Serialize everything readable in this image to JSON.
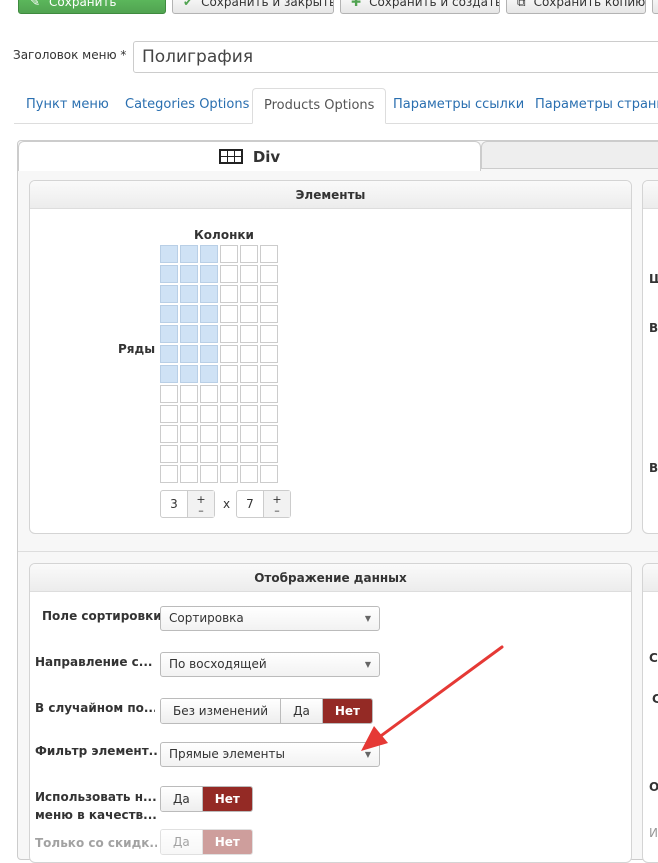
{
  "toolbar": {
    "save": "Сохранить",
    "save_close": "Сохранить и закрыть",
    "save_new": "Сохранить и создать",
    "save_copy": "Сохранить копию"
  },
  "menu_title": {
    "label": "Заголовок меню *",
    "value": "Полиграфия"
  },
  "tabs": [
    "Пункт меню",
    "Categories Options",
    "Products Options",
    "Параметры ссылки",
    "Параметры страницы"
  ],
  "active_tab": "Products Options",
  "subtab": {
    "label": "Div"
  },
  "elements_panel": {
    "title": "Элементы",
    "columns_label": "Колонки",
    "rows_label": "Ряды",
    "columns_value": "3",
    "rows_value": "7",
    "times": "x",
    "plus": "+",
    "minus": "–",
    "grid_selected": {
      "columns": 3,
      "rows": 7
    },
    "grid_size": {
      "columns": 6,
      "rows": 12
    }
  },
  "display_panel": {
    "title": "Отображение данных",
    "sort_field": {
      "label": "Поле сортировки",
      "value": "Сортировка"
    },
    "direction": {
      "label": "Направление с...",
      "value": "По восходящей"
    },
    "random": {
      "label": "В случайном по...",
      "options": [
        "Без изменений",
        "Да",
        "Нет"
      ],
      "selected": "Нет"
    },
    "filter": {
      "label": "Фильтр элемент...",
      "value": "Прямые элементы"
    },
    "use_menu": {
      "label_line1": "Использовать н...",
      "label_line2": "меню в качеств...",
      "options": [
        "Да",
        "Нет"
      ],
      "selected": "Нет"
    },
    "only_discount": {
      "label": "Только со скидк...",
      "options": [
        "Да",
        "Нет"
      ],
      "selected": "Нет"
    }
  },
  "right_clipped_letters": [
    "Ш",
    "В",
    "В",
    "С",
    "С",
    "О",
    "И"
  ],
  "colors": {
    "accent_green": "#51a351",
    "selected_red": "#942a25",
    "grid_selected": "#cfe2f5",
    "link_blue": "#2a6fb0",
    "arrow_red": "#e53935"
  }
}
